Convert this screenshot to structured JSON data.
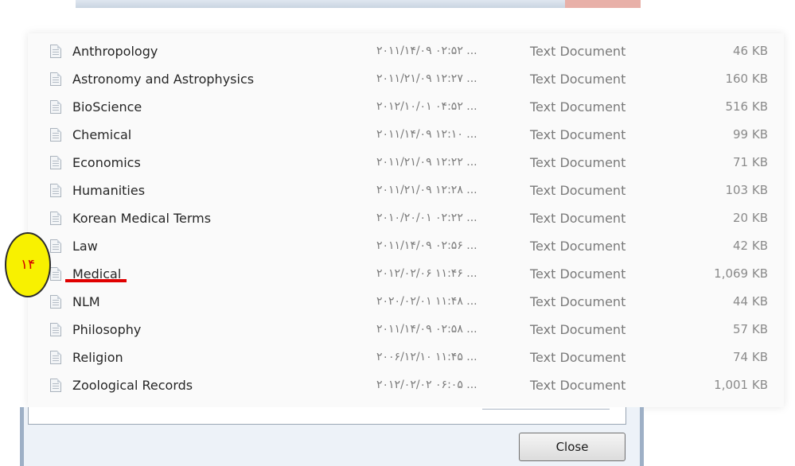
{
  "files": [
    {
      "name": "Anthropology",
      "date": "۲۰۱۱/۱۴/۰۹ ۰۲:۵۲ ...",
      "type": "Text Document",
      "size": "46 KB"
    },
    {
      "name": "Astronomy and Astrophysics",
      "date": "۲۰۱۱/۲۱/۰۹ ۱۲:۲۷ ...",
      "type": "Text Document",
      "size": "160 KB"
    },
    {
      "name": "BioScience",
      "date": "۲۰۱۲/۱۰/۰۱ ۰۴:۵۲ ...",
      "type": "Text Document",
      "size": "516 KB"
    },
    {
      "name": "Chemical",
      "date": "۲۰۱۱/۱۴/۰۹ ۱۲:۱۰ ...",
      "type": "Text Document",
      "size": "99 KB"
    },
    {
      "name": "Economics",
      "date": "۲۰۱۱/۲۱/۰۹ ۱۲:۲۲ ...",
      "type": "Text Document",
      "size": "71 KB"
    },
    {
      "name": "Humanities",
      "date": "۲۰۱۱/۲۱/۰۹ ۱۲:۲۸ ...",
      "type": "Text Document",
      "size": "103 KB"
    },
    {
      "name": "Korean Medical Terms",
      "date": "۲۰۱۰/۲۰/۰۱ ۰۲:۲۲ ...",
      "type": "Text Document",
      "size": "20 KB"
    },
    {
      "name": "Law",
      "date": "۲۰۱۱/۱۴/۰۹ ۰۲:۵۶ ...",
      "type": "Text Document",
      "size": "42 KB"
    },
    {
      "name": "Medical",
      "date": "۲۰۱۲/۰۲/۰۶ ۱۱:۴۶ ...",
      "type": "Text Document",
      "size": "1,069 KB"
    },
    {
      "name": "NLM",
      "date": "۲۰۲۰/۰۲/۰۱ ۱۱:۴۸ ...",
      "type": "Text Document",
      "size": "44 KB"
    },
    {
      "name": "Philosophy",
      "date": "۲۰۱۱/۱۴/۰۹ ۰۲:۵۸ ...",
      "type": "Text Document",
      "size": "57 KB"
    },
    {
      "name": "Religion",
      "date": "۲۰۰۶/۱۲/۱۰ ۱۱:۴۵ ...",
      "type": "Text Document",
      "size": "74 KB"
    },
    {
      "name": "Zoological Records",
      "date": "۲۰۱۲/۰۲/۰۲ ۰۶:۰۵ ...",
      "type": "Text Document",
      "size": "1,001 KB"
    }
  ],
  "annotation": {
    "label": "۱۴",
    "badge_color": "#f8f100",
    "underline_color": "#e00000"
  },
  "dialog": {
    "close_label": "Close"
  }
}
